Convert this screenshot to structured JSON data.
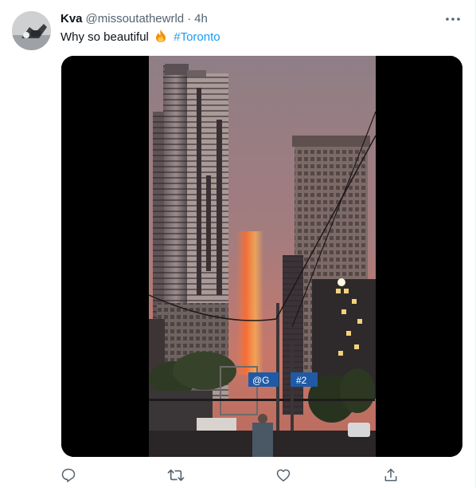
{
  "tweet": {
    "display_name": "Kva",
    "handle": "@missoutathewrld",
    "separator": "·",
    "timestamp": "4h",
    "text": "Why so beautiful",
    "emoji": "fire",
    "hashtag": "#Toronto"
  },
  "media": {
    "street_sign": "@G",
    "street_sign_2": "#2"
  },
  "actions": [
    "reply-icon",
    "retweet-icon",
    "like-icon",
    "share-icon"
  ],
  "colors": {
    "link": "#1d9bf0",
    "secondary_text": "#536471",
    "primary_text": "#0f1419"
  }
}
